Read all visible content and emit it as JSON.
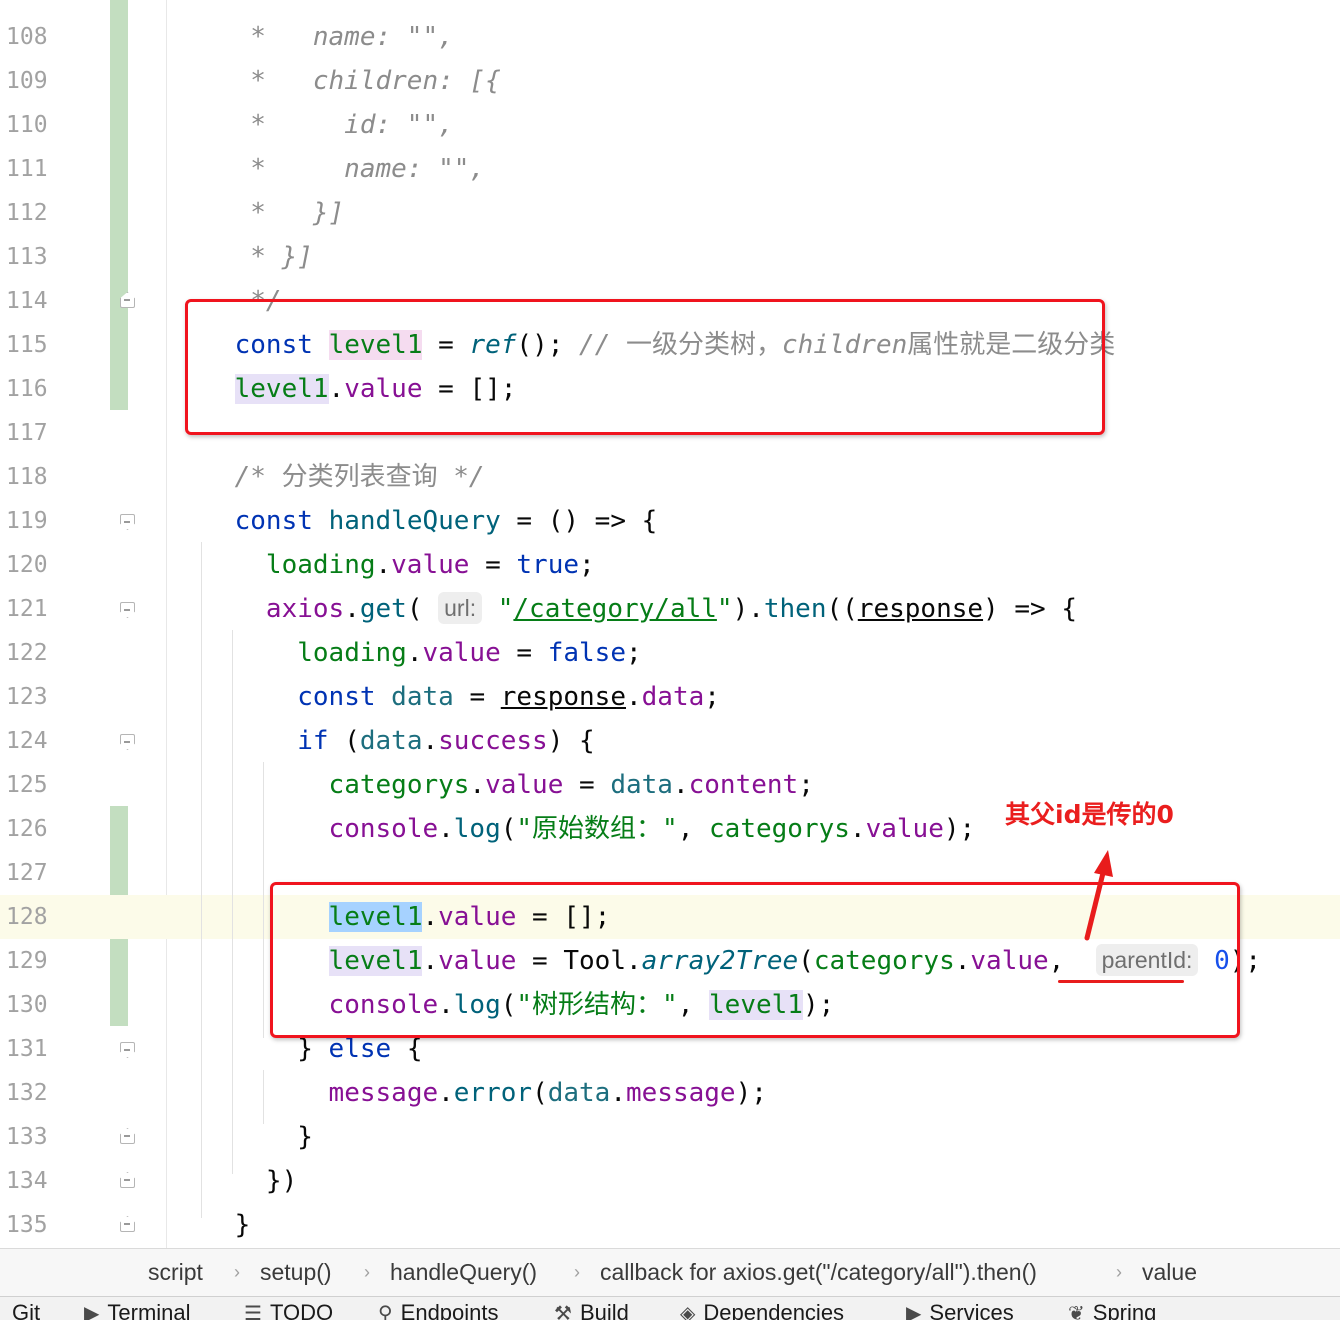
{
  "lines": [
    {
      "n": "108",
      "segs": [
        [
          "c",
          "     *   name: \"\","
        ]
      ]
    },
    {
      "n": "109",
      "segs": [
        [
          "c",
          "     *   children: [{"
        ]
      ]
    },
    {
      "n": "110",
      "segs": [
        [
          "c",
          "     *     id: \"\","
        ]
      ]
    },
    {
      "n": "111",
      "segs": [
        [
          "c",
          "     *     name: \"\","
        ]
      ]
    },
    {
      "n": "112",
      "segs": [
        [
          "c",
          "     *   }]"
        ]
      ]
    },
    {
      "n": "113",
      "segs": [
        [
          "c",
          "     * }]"
        ]
      ]
    },
    {
      "n": "114",
      "segs": [
        [
          "c",
          "     */"
        ]
      ]
    },
    {
      "n": "115",
      "segs": [
        [
          "pl",
          "    "
        ],
        [
          "k",
          "const"
        ],
        [
          "pl",
          " "
        ],
        [
          "v hl-pink",
          "level1"
        ],
        [
          "pl",
          " = "
        ],
        [
          "fi",
          "ref"
        ],
        [
          "pl",
          "(); "
        ],
        [
          "c",
          "// "
        ],
        [
          "cn",
          "一级分类树，"
        ],
        [
          "c",
          "children"
        ],
        [
          "cn",
          "属性就是二级分类"
        ]
      ]
    },
    {
      "n": "116",
      "segs": [
        [
          "pl",
          "    "
        ],
        [
          "v hl-purple",
          "level1"
        ],
        [
          "pl",
          "."
        ],
        [
          "p",
          "value"
        ],
        [
          "pl",
          " = [];"
        ]
      ]
    },
    {
      "n": "117",
      "segs": []
    },
    {
      "n": "118",
      "segs": [
        [
          "pl",
          "    "
        ],
        [
          "c",
          "/* "
        ],
        [
          "cn",
          "分类列表查询"
        ],
        [
          "c",
          " */"
        ]
      ]
    },
    {
      "n": "119",
      "segs": [
        [
          "pl",
          "    "
        ],
        [
          "k",
          "const"
        ],
        [
          "pl",
          " "
        ],
        [
          "fn",
          "handleQuery"
        ],
        [
          "pl",
          " = () => {"
        ]
      ]
    },
    {
      "n": "120",
      "segs": [
        [
          "pl",
          "      "
        ],
        [
          "v",
          "loading"
        ],
        [
          "pl",
          "."
        ],
        [
          "p",
          "value"
        ],
        [
          "pl",
          " = "
        ],
        [
          "k",
          "true"
        ],
        [
          "pl",
          ";"
        ]
      ]
    },
    {
      "n": "121",
      "segs": [
        [
          "pl",
          "      "
        ],
        [
          "p",
          "axios"
        ],
        [
          "pl",
          "."
        ],
        [
          "fn",
          "get"
        ],
        [
          "pl",
          "( "
        ],
        [
          "hint",
          "url:"
        ],
        [
          "pl",
          " "
        ],
        [
          "s",
          "\""
        ],
        [
          "su",
          "/category/all"
        ],
        [
          "s",
          "\""
        ],
        [
          "pl",
          ")."
        ],
        [
          "fn",
          "then"
        ],
        [
          "pl",
          "(("
        ],
        [
          "par",
          "response"
        ],
        [
          "pl",
          ") => {"
        ]
      ]
    },
    {
      "n": "122",
      "segs": [
        [
          "pl",
          "        "
        ],
        [
          "v",
          "loading"
        ],
        [
          "pl",
          "."
        ],
        [
          "p",
          "value"
        ],
        [
          "pl",
          " = "
        ],
        [
          "k",
          "false"
        ],
        [
          "pl",
          ";"
        ]
      ]
    },
    {
      "n": "123",
      "segs": [
        [
          "pl",
          "        "
        ],
        [
          "k",
          "const"
        ],
        [
          "pl",
          " "
        ],
        [
          "g",
          "data"
        ],
        [
          "pl",
          " = "
        ],
        [
          "par",
          "response"
        ],
        [
          "pl",
          "."
        ],
        [
          "p",
          "data"
        ],
        [
          "pl",
          ";"
        ]
      ]
    },
    {
      "n": "124",
      "segs": [
        [
          "pl",
          "        "
        ],
        [
          "k",
          "if"
        ],
        [
          "pl",
          " ("
        ],
        [
          "g",
          "data"
        ],
        [
          "pl",
          "."
        ],
        [
          "p",
          "success"
        ],
        [
          "pl",
          ") {"
        ]
      ]
    },
    {
      "n": "125",
      "segs": [
        [
          "pl",
          "          "
        ],
        [
          "v",
          "categorys"
        ],
        [
          "pl",
          "."
        ],
        [
          "p",
          "value"
        ],
        [
          "pl",
          " = "
        ],
        [
          "g",
          "data"
        ],
        [
          "pl",
          "."
        ],
        [
          "p",
          "content"
        ],
        [
          "pl",
          ";"
        ]
      ]
    },
    {
      "n": "126",
      "segs": [
        [
          "pl",
          "          "
        ],
        [
          "p",
          "console"
        ],
        [
          "pl",
          "."
        ],
        [
          "fn",
          "log"
        ],
        [
          "pl",
          "("
        ],
        [
          "s",
          "\"原始数组：\""
        ],
        [
          "pl",
          ", "
        ],
        [
          "v",
          "categorys"
        ],
        [
          "pl",
          "."
        ],
        [
          "p",
          "value"
        ],
        [
          "pl",
          ");"
        ]
      ]
    },
    {
      "n": "127",
      "segs": []
    },
    {
      "n": "128",
      "segs": [
        [
          "pl",
          "          "
        ],
        [
          "v hl-blue",
          "level1"
        ],
        [
          "pl",
          "."
        ],
        [
          "p",
          "value"
        ],
        [
          "pl",
          " = [];"
        ]
      ]
    },
    {
      "n": "129",
      "segs": [
        [
          "pl",
          "          "
        ],
        [
          "v hl-purple",
          "level1"
        ],
        [
          "pl",
          "."
        ],
        [
          "p",
          "value"
        ],
        [
          "pl",
          " = Tool."
        ],
        [
          "fi",
          "array2Tree"
        ],
        [
          "pl",
          "("
        ],
        [
          "v",
          "categorys"
        ],
        [
          "pl",
          "."
        ],
        [
          "p",
          "value"
        ],
        [
          "pl",
          ",  "
        ],
        [
          "hint",
          "parentId:"
        ],
        [
          "pl",
          " "
        ],
        [
          "num",
          "0"
        ],
        [
          "pl",
          ");"
        ]
      ]
    },
    {
      "n": "130",
      "segs": [
        [
          "pl",
          "          "
        ],
        [
          "p",
          "console"
        ],
        [
          "pl",
          "."
        ],
        [
          "fn",
          "log"
        ],
        [
          "pl",
          "("
        ],
        [
          "s",
          "\"树形结构：\""
        ],
        [
          "pl",
          ", "
        ],
        [
          "v hl-purple",
          "level1"
        ],
        [
          "pl",
          ");"
        ]
      ]
    },
    {
      "n": "131",
      "segs": [
        [
          "pl",
          "        } "
        ],
        [
          "k",
          "else"
        ],
        [
          "pl",
          " {"
        ]
      ]
    },
    {
      "n": "132",
      "segs": [
        [
          "pl",
          "          "
        ],
        [
          "p",
          "message"
        ],
        [
          "pl",
          "."
        ],
        [
          "fn",
          "error"
        ],
        [
          "pl",
          "("
        ],
        [
          "g",
          "data"
        ],
        [
          "pl",
          "."
        ],
        [
          "p",
          "message"
        ],
        [
          "pl",
          ");"
        ]
      ]
    },
    {
      "n": "133",
      "segs": [
        [
          "pl",
          "        }"
        ]
      ]
    },
    {
      "n": "134",
      "segs": [
        [
          "pl",
          "      })"
        ]
      ]
    },
    {
      "n": "135",
      "segs": [
        [
          "pl",
          "    }"
        ]
      ]
    }
  ],
  "annotation": "其父id是传的0",
  "breadcrumb": [
    "script",
    "setup()",
    "handleQuery()",
    "callback for axios.get(\"/category/all\").then()",
    "value"
  ],
  "toolwindows": [
    {
      "icon": "",
      "label": "Git"
    },
    {
      "icon": "▶",
      "label": "Terminal"
    },
    {
      "icon": "☰",
      "label": "TODO"
    },
    {
      "icon": "⚲",
      "label": "Endpoints"
    },
    {
      "icon": "⚒",
      "label": "Build"
    },
    {
      "icon": "◈",
      "label": "Dependencies"
    },
    {
      "icon": "▶",
      "label": "Services"
    },
    {
      "icon": "❦",
      "label": "Spring"
    }
  ],
  "colors": {
    "annotation_red": "#f0141e",
    "vcs_added": "#c3dec0",
    "current_line": "#fcfbe9"
  }
}
